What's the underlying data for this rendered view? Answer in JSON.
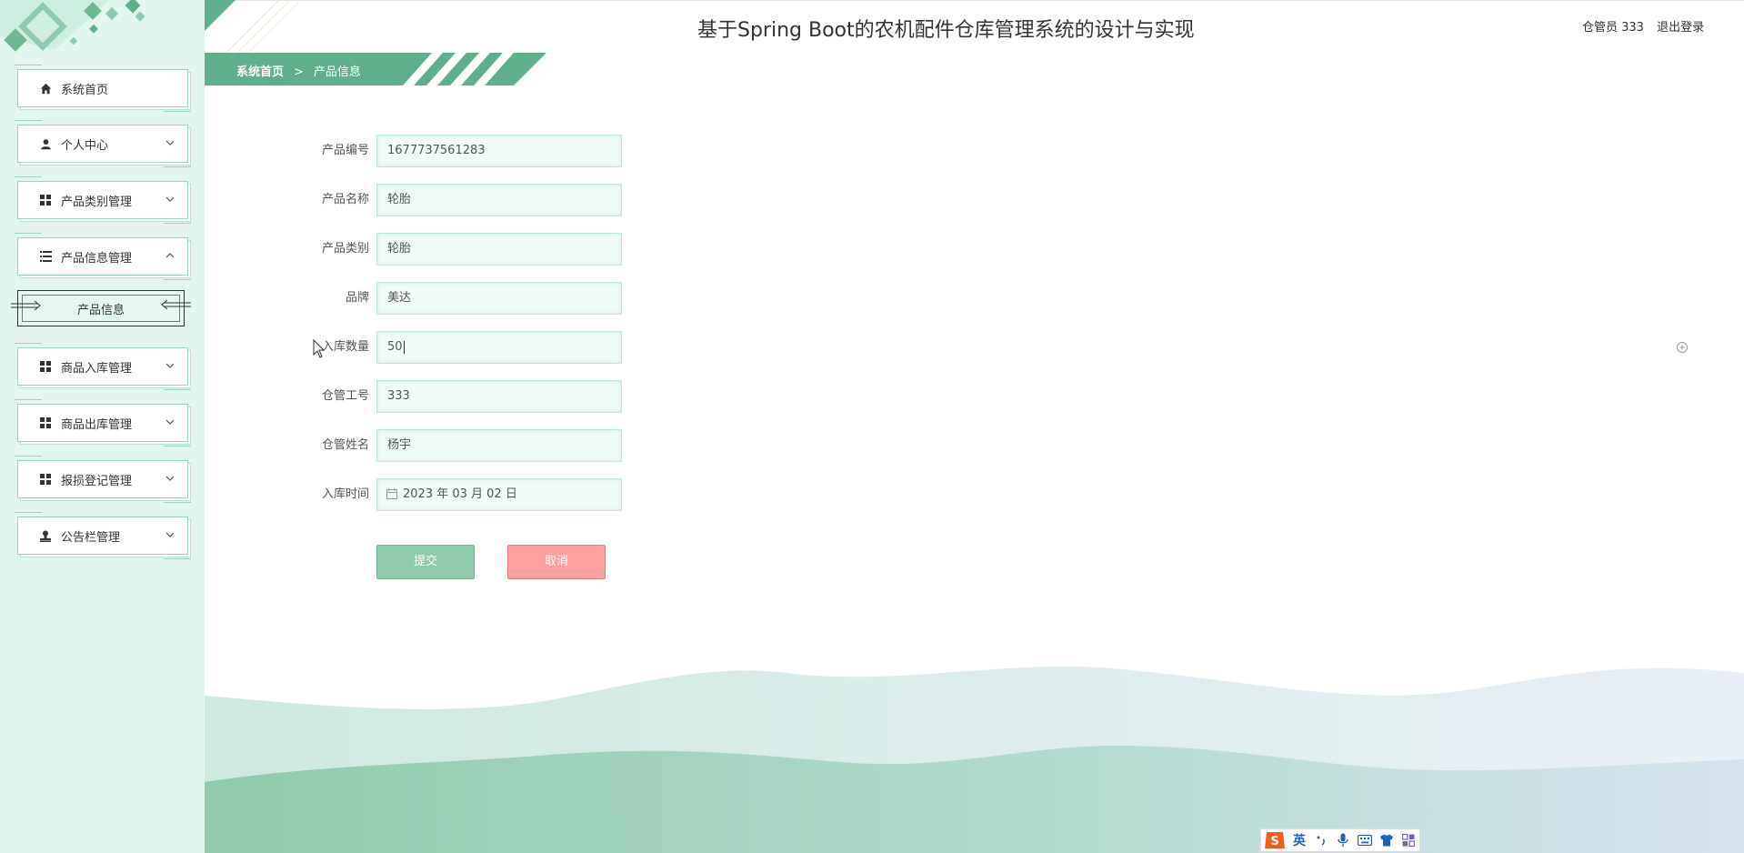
{
  "header": {
    "title": "基于Spring Boot的农机配件仓库管理系统的设计与实现",
    "user_label": "仓管员 333",
    "logout_label": "退出登录"
  },
  "breadcrumb": {
    "home": "系统首页",
    "separator": ">",
    "current": "产品信息"
  },
  "sidebar": {
    "items": [
      {
        "label": "系统首页",
        "icon": "home-icon",
        "expandable": false
      },
      {
        "label": "个人中心",
        "icon": "user-icon",
        "expandable": true
      },
      {
        "label": "产品类别管理",
        "icon": "grid-icon",
        "expandable": true
      },
      {
        "label": "产品信息管理",
        "icon": "list-icon",
        "expandable": true,
        "expanded": true
      },
      {
        "label": "商品入库管理",
        "icon": "grid-icon",
        "expandable": true
      },
      {
        "label": "商品出库管理",
        "icon": "grid-icon",
        "expandable": true
      },
      {
        "label": "报损登记管理",
        "icon": "grid-icon",
        "expandable": true
      },
      {
        "label": "公告栏管理",
        "icon": "stamp-icon",
        "expandable": true
      }
    ],
    "sub_item": {
      "label": "产品信息"
    }
  },
  "form": {
    "fields": [
      {
        "label": "产品编号",
        "value": "1677737561283"
      },
      {
        "label": "产品名称",
        "value": "轮胎"
      },
      {
        "label": "产品类别",
        "value": "轮胎"
      },
      {
        "label": "品牌",
        "value": "美达"
      },
      {
        "label": "入库数量",
        "value": "50"
      },
      {
        "label": "仓管工号",
        "value": "333"
      },
      {
        "label": "仓管姓名",
        "value": "杨宇"
      },
      {
        "label": "入库时间",
        "value": "2023 年 03 月 02 日",
        "icon": "calendar-icon"
      }
    ],
    "submit_label": "提交",
    "cancel_label": "取消"
  },
  "ime": {
    "mode": "英",
    "icons": [
      "sogou-logo-icon",
      "punctuation-icon",
      "microphone-icon",
      "keyboard-icon",
      "skin-icon",
      "toolbox-icon"
    ]
  },
  "colors": {
    "accent": "#5fae8c",
    "sidebar_bg": "#e2f5ee",
    "submit": "#8fcaac",
    "cancel": "#fe9fa0"
  }
}
